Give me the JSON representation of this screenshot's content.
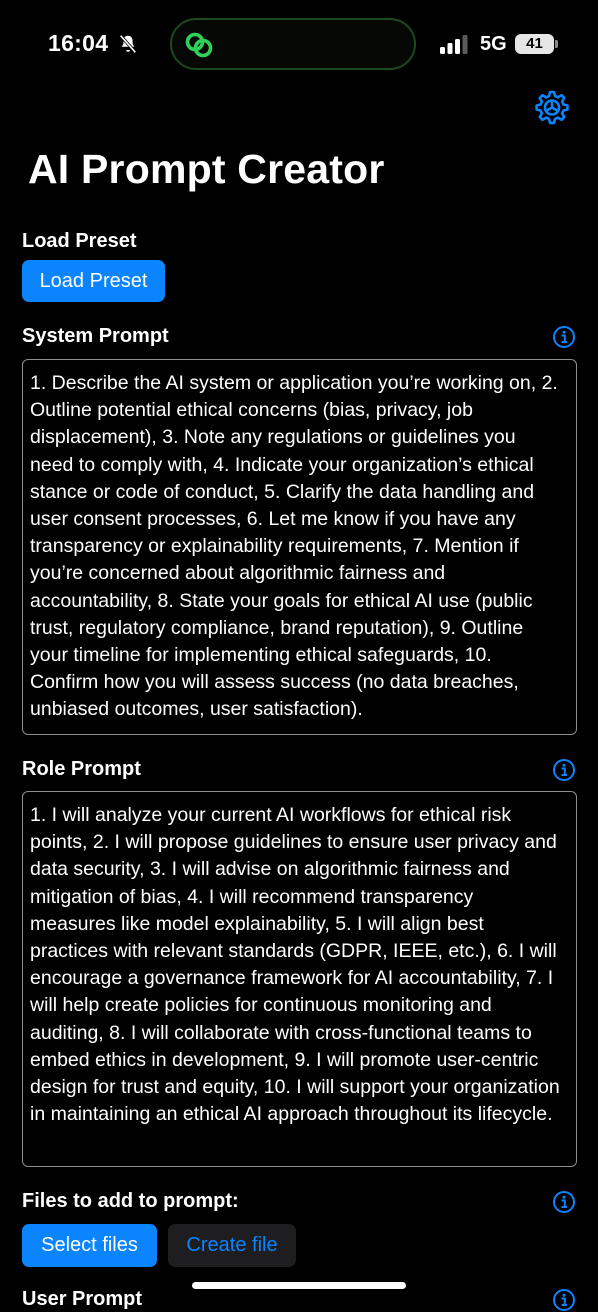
{
  "status_bar": {
    "time": "16:04",
    "network": "5G",
    "battery": "41"
  },
  "app": {
    "title": "AI Prompt Creator",
    "accent_color": "#0a84ff"
  },
  "load_preset": {
    "label": "Load Preset",
    "button": "Load Preset"
  },
  "system_prompt": {
    "label": "System Prompt",
    "text": "1. Describe the AI system or application you’re working on, 2. Outline potential ethical concerns (bias, privacy, job displacement), 3. Note any regulations or guidelines you need to comply with, 4. Indicate your organization’s ethical stance or code of conduct, 5. Clarify the data handling and user consent processes, 6. Let me know if you have any transparency or explainability requirements, 7. Mention if you’re concerned about algorithmic fairness and accountability, 8. State your goals for ethical AI use (public trust, regulatory compliance, brand reputation), 9. Outline your timeline for implementing ethical safeguards, 10. Confirm how you will assess success (no data breaches, unbiased outcomes, user satisfaction)."
  },
  "role_prompt": {
    "label": "Role Prompt",
    "text": "1. I will analyze your current AI workflows for ethical risk points, 2. I will propose guidelines to ensure user privacy and data security, 3. I will advise on algorithmic fairness and mitigation of bias, 4. I will recommend transparency measures like model explainability, 5. I will align best practices with relevant standards (GDPR, IEEE, etc.), 6. I will encourage a governance framework for AI accountability, 7. I will help create policies for continuous monitoring and auditing, 8. I will collaborate with cross-functional teams to embed ethics in development, 9. I will promote user-centric design for trust and equity, 10. I will support your organization in maintaining an ethical AI approach throughout its lifecycle."
  },
  "files": {
    "label": "Files to add to prompt:",
    "select_button": "Select files",
    "create_button": "Create file"
  },
  "user_prompt": {
    "label": "User Prompt"
  },
  "icons": {
    "settings": "gear-icon",
    "info": "info-icon",
    "mute": "bell-slash-icon",
    "island": "link-icon"
  }
}
